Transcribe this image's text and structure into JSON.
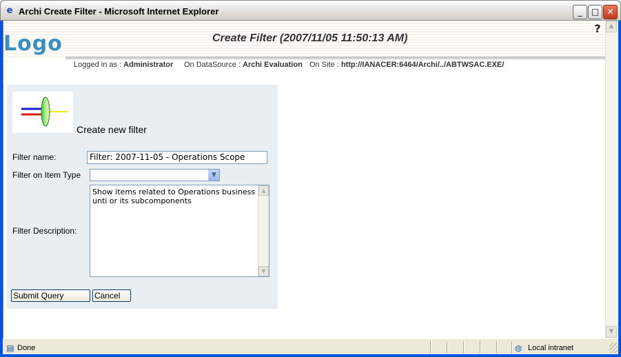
{
  "window": {
    "title": "Archi Create Filter - Microsoft Internet Explorer",
    "minimize": "_",
    "maximize": "□",
    "close": "✕"
  },
  "header": {
    "logo": "Logo",
    "title": "Create Filter (2007/11/05 11:50:13 AM)",
    "help": "?"
  },
  "meta": {
    "logged_label": "Logged in as : ",
    "logged_value": "Administrator",
    "datasource_label": "On DataSource : ",
    "datasource_value": "Archi Evaluation",
    "site_label": "On Site : ",
    "site_value": "http://IANACER:6464/Archi/../ABTWSAC.EXE/"
  },
  "form": {
    "heading": "Create new filter",
    "filter_name_label": "Filter name:",
    "filter_name_value": "Filter: 2007-11-05 - Operations Scope",
    "item_type_label": "Filter on Item Type",
    "item_type_value": "",
    "description_label": "Filter Description:",
    "description_value": "Show items related to Operations business unti or its subcomponents",
    "submit_label": "Submit Query",
    "cancel_label": "Cancel"
  },
  "statusbar": {
    "status": "Done",
    "zone": "Local intranet"
  },
  "colors": {
    "titlebar_bg": "#e6e6e6",
    "panel_bg": "#e9eef2",
    "logo": "#3b8fbf",
    "input_border": "#7f9db9"
  },
  "icons": {
    "title_icon": "ie-page-icon",
    "help_icon": "help-icon",
    "status_icon": "page-icon",
    "zone_icon": "intranet-globe-icon"
  }
}
